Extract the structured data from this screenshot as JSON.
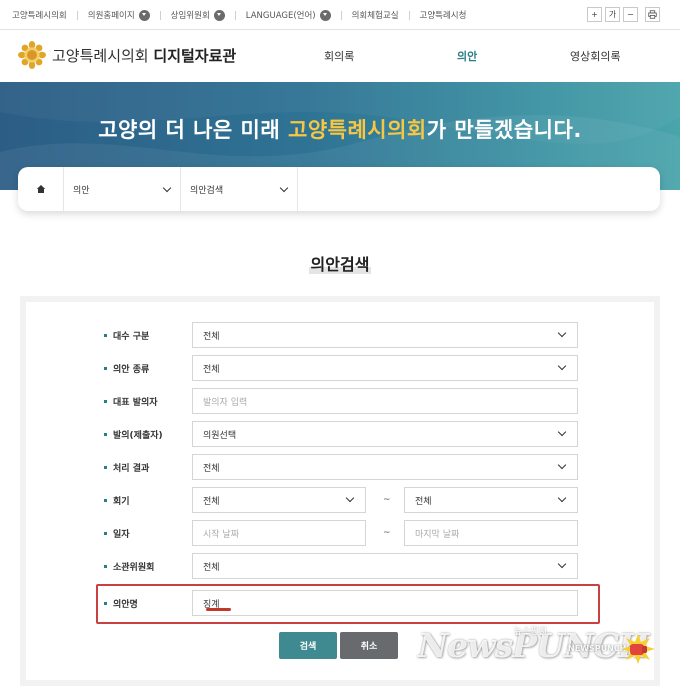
{
  "topbar": {
    "links": [
      {
        "label": "고양특례시의회",
        "dropdown": false
      },
      {
        "label": "의원홈페이지",
        "dropdown": true
      },
      {
        "label": "상임위원회",
        "dropdown": true
      },
      {
        "label": "LANGUAGE(언어)",
        "dropdown": true
      },
      {
        "label": "의회체험교실",
        "dropdown": false
      },
      {
        "label": "고양특례시청",
        "dropdown": false
      }
    ],
    "font_controls": [
      "+",
      "가",
      "−"
    ],
    "print_icon": "print-icon"
  },
  "header": {
    "logo_prefix": "고양특례시의회",
    "logo_suffix": "디지털자료관",
    "nav": [
      {
        "label": "회의록",
        "active": false
      },
      {
        "label": "의안",
        "active": true
      },
      {
        "label": "영상회의록",
        "active": false
      }
    ]
  },
  "banner": {
    "title_before": "고양의 더 나은 미래 ",
    "title_highlight": "고양특례시의회",
    "title_after": "가 만들겠습니다."
  },
  "breadcrumb": {
    "home_icon": "home-icon",
    "level1": "의안",
    "level2": "의안검색"
  },
  "page_title": "의안검색",
  "form": {
    "daesu": {
      "label": "대수 구분",
      "value": "전체"
    },
    "type": {
      "label": "의안 종류",
      "value": "전체"
    },
    "proposer": {
      "label": "대표 발의자",
      "placeholder": "발의자 입력"
    },
    "submitter": {
      "label": "발의(제출자)",
      "value": "의원선택"
    },
    "result": {
      "label": "처리 결과",
      "value": "전체"
    },
    "session": {
      "label": "회기",
      "from": "전체",
      "to": "전체",
      "separator": "~"
    },
    "date": {
      "label": "일자",
      "start_placeholder": "시작 날짜",
      "end_placeholder": "마지막 날짜",
      "separator": "~"
    },
    "committee": {
      "label": "소관위원회",
      "value": "전체"
    },
    "title": {
      "label": "의안명",
      "value": "징계"
    }
  },
  "buttons": {
    "search": "검색",
    "cancel": "취소"
  },
  "watermark": {
    "main": "NewsPUNCH",
    "sub": "뉴스펀치",
    "tag": "NEWSPUNCH"
  },
  "colors": {
    "accent": "#2a7e86",
    "highlight_yellow": "#f5c745",
    "callout_red": "#c94040"
  }
}
